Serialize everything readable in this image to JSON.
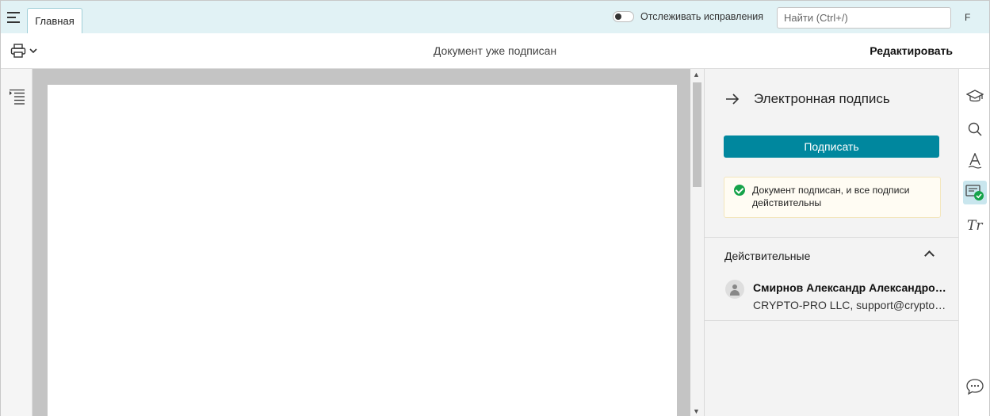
{
  "colors": {
    "accent": "#00879e",
    "topbar": "#e1f2f5",
    "success": "#16a34a"
  },
  "topbar": {
    "tab_label": "Главная",
    "track_changes_label": "Отслеживать исправления",
    "search_placeholder": "Найти (Ctrl+/)",
    "user_initial": "F"
  },
  "toolbar": {
    "status": "Документ уже подписан",
    "edit_label": "Редактировать"
  },
  "panel": {
    "title": "Электронная подпись",
    "sign_button": "Подписать",
    "notice_text": "Документ подписан, и все подписи действительны",
    "section_title": "Действительные",
    "signer": {
      "name": "Смирнов Александр Александрович",
      "org": "CRYPTO-PRO LLC, support@cryptopro.ru"
    }
  },
  "icons": {
    "left_rail": [
      "outline-icon"
    ],
    "right_rail": [
      "graduation-cap-icon",
      "search-icon",
      "text-style-icon",
      "signature-icon",
      "text-format-icon",
      "chat-icon"
    ]
  }
}
